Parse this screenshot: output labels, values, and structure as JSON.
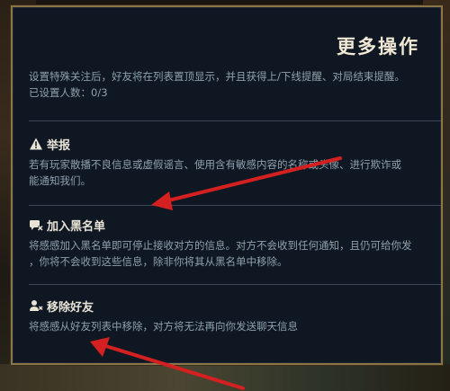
{
  "panel": {
    "title": "更多操作",
    "intro_line1": "设置特殊关注后，好友将在列表置顶显示，并且获得上/下线提醒、对局结束提醒。",
    "intro_line2": "已设置人数：0/3"
  },
  "sections": [
    {
      "icon": "warning-icon",
      "title": "举报",
      "desc_line1": "若有玩家散播不良信息或虚假谣言、使用含有敏感内容的名称或头像、进行欺诈或",
      "desc_line2": "能通知我们。"
    },
    {
      "icon": "block-user-icon",
      "title": "加入黑名单",
      "desc_line1": "将感感加入黑名单即可停止接收对方的信息。对方不会收到任何通知，且仍可给你发",
      "desc_line2": "，你将不会收到这些信息，除非你将其从黑名单中移除。"
    },
    {
      "icon": "remove-friend-icon",
      "title": "移除好友",
      "desc_line1": "将感感从好友列表中移除，对方将无法再向你发送聊天信息"
    }
  ],
  "colors": {
    "panel_bg": "#0f1822",
    "border_gold": "#8a7448",
    "arrow_red": "#d42020"
  }
}
